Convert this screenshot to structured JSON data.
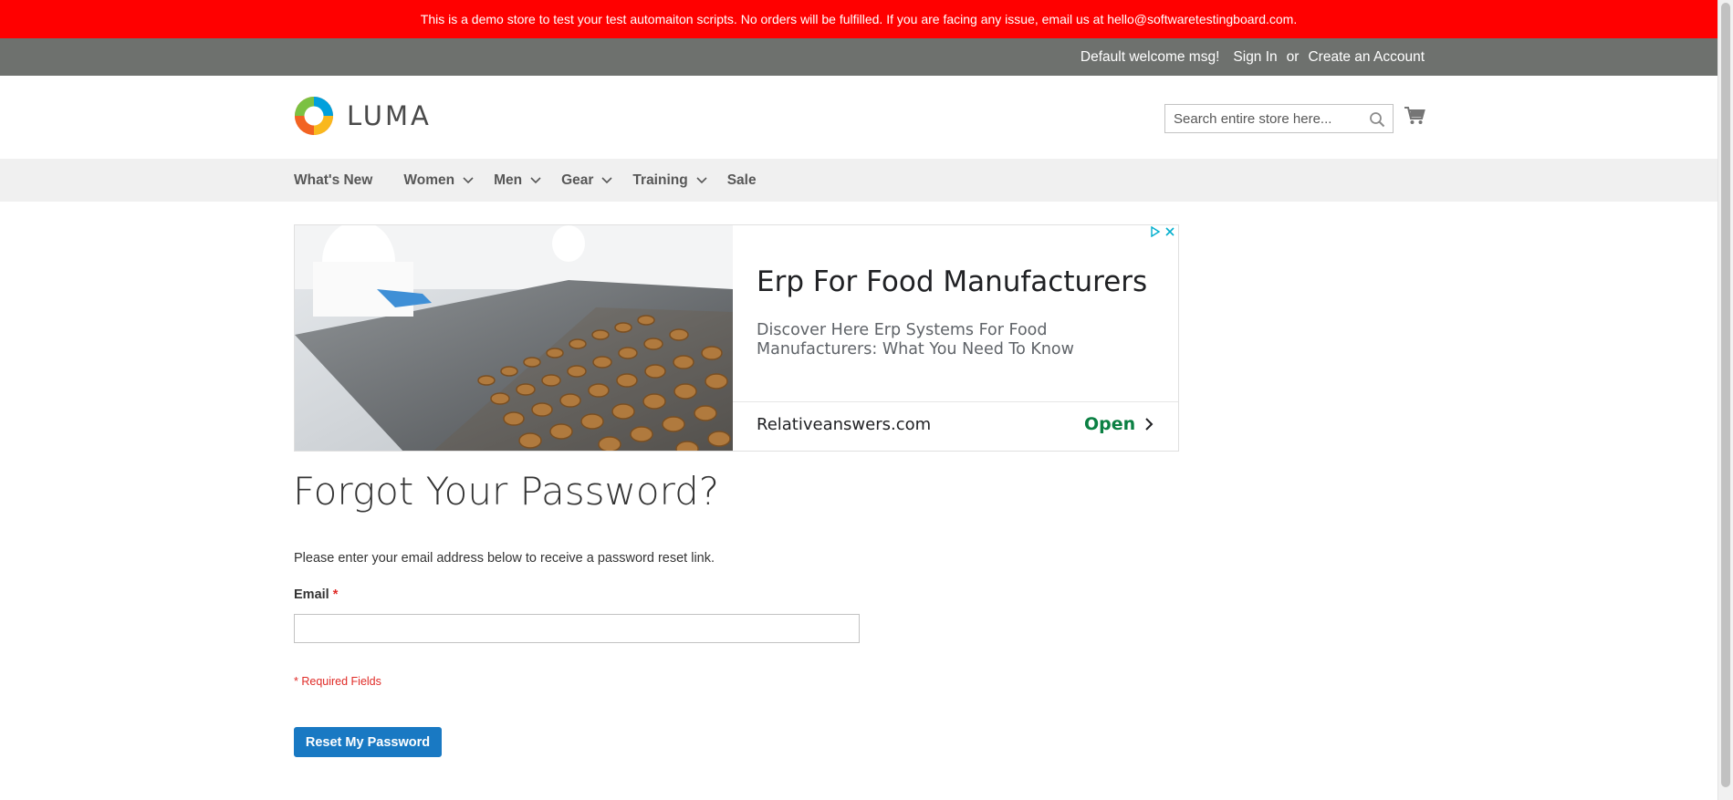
{
  "demo_notice": "This is a demo store to test your test automaiton scripts. No orders will be fulfilled. If you are facing any issue, email us at hello@softwaretestingboard.com.",
  "header_panel": {
    "welcome": "Default welcome msg!",
    "sign_in": "Sign In",
    "or": "or",
    "create_account": "Create an Account"
  },
  "logo": {
    "text": "LUMA",
    "icon": "luma-logo-icon"
  },
  "search": {
    "placeholder": "Search entire store here...",
    "icon": "search-icon"
  },
  "cart": {
    "icon": "cart-icon"
  },
  "nav": {
    "items": [
      {
        "label": "What's New",
        "has_submenu": false
      },
      {
        "label": "Women",
        "has_submenu": true
      },
      {
        "label": "Men",
        "has_submenu": true
      },
      {
        "label": "Gear",
        "has_submenu": true
      },
      {
        "label": "Training",
        "has_submenu": true
      },
      {
        "label": "Sale",
        "has_submenu": false
      }
    ]
  },
  "ad": {
    "headline": "Erp For Food Manufacturers",
    "description": "Discover Here Erp Systems For Food Manufacturers: What You Need To Know",
    "domain": "Relativeanswers.com",
    "cta": "Open"
  },
  "page": {
    "title": "Forgot Your Password?",
    "intro": "Please enter your email address below to receive a password reset link.",
    "email_label": "Email",
    "email_value": "",
    "required_marker": "*",
    "required_note": "* Required Fields",
    "submit_label": "Reset My Password"
  },
  "colors": {
    "notice_bg": "#ff0000",
    "panel_bg": "#6e716e",
    "nav_bg": "#f0f0f0",
    "primary_button": "#1979c3",
    "required": "#e02b27",
    "ad_cta": "#0b8043"
  }
}
